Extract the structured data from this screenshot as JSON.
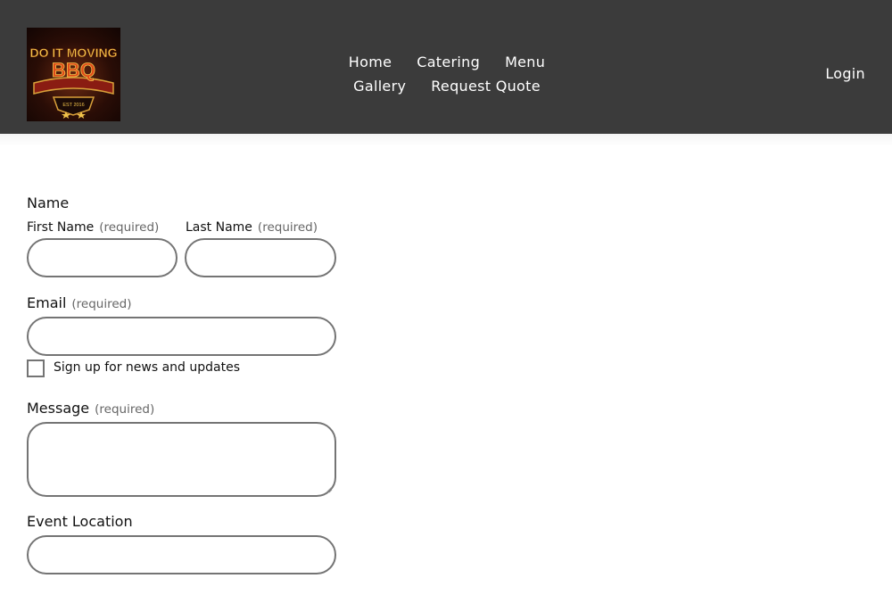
{
  "brand": {
    "logo_line1": "DO IT MOVING",
    "logo_line2": "BBQ",
    "logo_est": "EST 2016"
  },
  "nav": {
    "items": [
      {
        "label": "Home"
      },
      {
        "label": "Catering"
      },
      {
        "label": "Menu"
      },
      {
        "label": "Gallery"
      },
      {
        "label": "Request Quote"
      }
    ],
    "login_label": "Login"
  },
  "form": {
    "name_legend": "Name",
    "first_name_label": "First Name",
    "last_name_label": "Last Name",
    "required_text": "(required)",
    "email_label": "Email",
    "newsletter_label": "Sign up for news and updates",
    "message_label": "Message",
    "event_location_label": "Event Location"
  },
  "colors": {
    "header_bg": "#3b3b3b",
    "field_border": "#747474",
    "nav_text": "#ffffff"
  }
}
